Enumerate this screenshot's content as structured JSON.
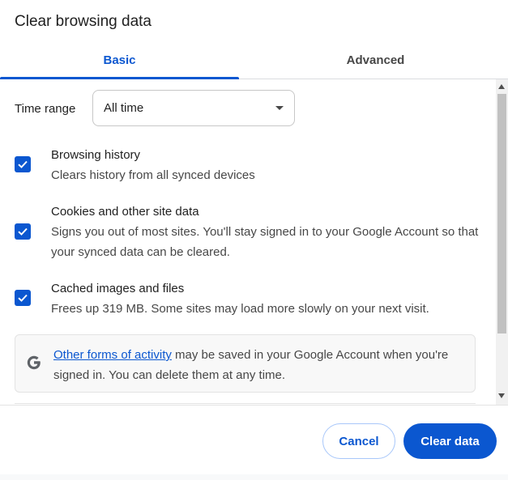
{
  "dialog": {
    "title": "Clear browsing data"
  },
  "tabs": [
    {
      "label": "Basic",
      "selected": true
    },
    {
      "label": "Advanced",
      "selected": false
    }
  ],
  "time_range": {
    "label": "Time range",
    "value": "All time"
  },
  "options": [
    {
      "title": "Browsing history",
      "description": "Clears history from all synced devices",
      "checked": true
    },
    {
      "title": "Cookies and other site data",
      "description": "Signs you out of most sites. You'll stay signed in to your Google Account so that your synced data can be cleared.",
      "checked": true
    },
    {
      "title": "Cached images and files",
      "description": "Frees up 319 MB. Some sites may load more slowly on your next visit.",
      "checked": true
    }
  ],
  "info": {
    "icon": "google-g-icon",
    "link_text": "Other forms of activity",
    "text": " may be saved in your Google Account when you're signed in. You can delete them at any time."
  },
  "buttons": {
    "cancel": "Cancel",
    "clear": "Clear data"
  },
  "colors": {
    "accent": "#0b57d0",
    "text_secondary": "#474747",
    "info_bg": "#f8f8f8"
  }
}
